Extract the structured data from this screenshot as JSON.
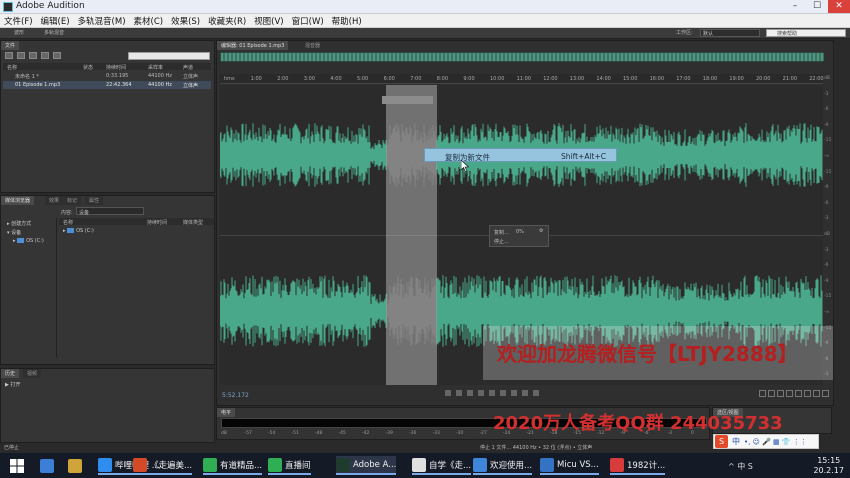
{
  "window": {
    "title": "Adobe Audition",
    "controls": [
      "–",
      "☐",
      "✕"
    ]
  },
  "menu": [
    "文件(F)",
    "编辑(E)",
    "多轨混音(M)",
    "素材(C)",
    "效果(S)",
    "收藏夹(R)",
    "视图(V)",
    "窗口(W)",
    "帮助(H)"
  ],
  "toolbar": {
    "waveform_label": "波形",
    "multitrack_label": "多轨混音",
    "workspace_label": "工作区:",
    "workspace_value": "默认",
    "help_search_placeholder": "搜索帮助"
  },
  "files_panel": {
    "tab": "文件",
    "columns": [
      "名称",
      "状态",
      "持续时间",
      "采样率",
      "声道"
    ],
    "rows": [
      {
        "name": "未命名 1 *",
        "duration": "0:33.195",
        "rate": "44100 Hz",
        "channels": "立体声"
      },
      {
        "name": "01 Episode 1.mp3",
        "duration": "22:42.364",
        "rate": "44100 Hz",
        "channels": "立体声"
      }
    ]
  },
  "media_panel": {
    "tabs": [
      "媒体浏览器",
      "效果",
      "标记",
      "属性"
    ],
    "content_label": "内容:",
    "content_value": "设备",
    "tree": [
      "创建方式",
      "设备",
      "OS (C:)"
    ],
    "list_columns": [
      "名称",
      "持续时间",
      "媒体类型"
    ],
    "list_items": [
      "OS (C:)"
    ]
  },
  "history_panel": {
    "tabs": [
      "历史",
      "视频"
    ],
    "item": "打开"
  },
  "editor": {
    "tabs": [
      "编辑器: 01 Episode 1.mp3",
      "混音器"
    ],
    "ruler_ticks": [
      "hms",
      "1:00",
      "2:00",
      "3:00",
      "4:00",
      "5:00",
      "6:00",
      "7:00",
      "8:00",
      "9:00",
      "10:00",
      "11:00",
      "12:00",
      "13:00",
      "14:00",
      "15:00",
      "16:00",
      "17:00",
      "18:00",
      "19:00",
      "20:00",
      "21:00",
      "22:00"
    ],
    "db_scale": [
      "dB",
      "-3",
      "-6",
      "-9",
      "-15",
      "-∞",
      "-15",
      "-9",
      "-6",
      "-3",
      "dB",
      "-3",
      "-6",
      "-9",
      "-15",
      "-∞",
      "-15",
      "-9",
      "-6",
      "-3"
    ],
    "time_readout": "5:52.172"
  },
  "context_menu": {
    "item": "复制为新文件",
    "shortcut": "Shift+Alt+C"
  },
  "progress": {
    "label": "复制...",
    "percent": "0%",
    "cancel": "停止..."
  },
  "levels": {
    "tab": "电平",
    "scale": [
      "dB",
      "-57",
      "-54",
      "-51",
      "-48",
      "-45",
      "-42",
      "-39",
      "-36",
      "-33",
      "-30",
      "-27",
      "-24",
      "-21",
      "-18",
      "-15",
      "-12",
      "-9",
      "-6",
      "-3",
      "0"
    ]
  },
  "selection_panel": {
    "tab": "选区/视图"
  },
  "status": {
    "left": "已停止",
    "right": "停止 1 文件... 44100 Hz • 32 位 (浮点) • 立体声"
  },
  "watermark": {
    "line1": "欢迎加龙腾微信号【LTJY2888】",
    "line2": "2020万人备考QQ群 244035733"
  },
  "ime": {
    "logo": "S",
    "lang": "中",
    "symbols": "•, ☺ 🎤 ▦ 👕 ⋮⋮"
  },
  "taskbar": {
    "items": [
      {
        "label": "",
        "color": "#3c7fd6"
      },
      {
        "label": "",
        "color": "#cfa53a"
      },
      {
        "label": "哔哩哔哩 ...",
        "color": "#2f8df0"
      },
      {
        "label": "《走遍美...",
        "color": "#d44a26"
      },
      {
        "label": "有道精品...",
        "color": "#2fae53"
      },
      {
        "label": "直播间",
        "color": "#2fae53"
      },
      {
        "label": "Adobe A...",
        "color": "#1e3b2e"
      },
      {
        "label": "自学《走...",
        "color": "#e0e0e0"
      },
      {
        "label": "欢迎使用...",
        "color": "#3d86d9"
      },
      {
        "label": "Micu VS...",
        "color": "#3473c4"
      },
      {
        "label": "1982计...",
        "color": "#d83b3b"
      }
    ],
    "tray": "^ 中 S",
    "time": "15:15",
    "date": "20.2.17"
  }
}
